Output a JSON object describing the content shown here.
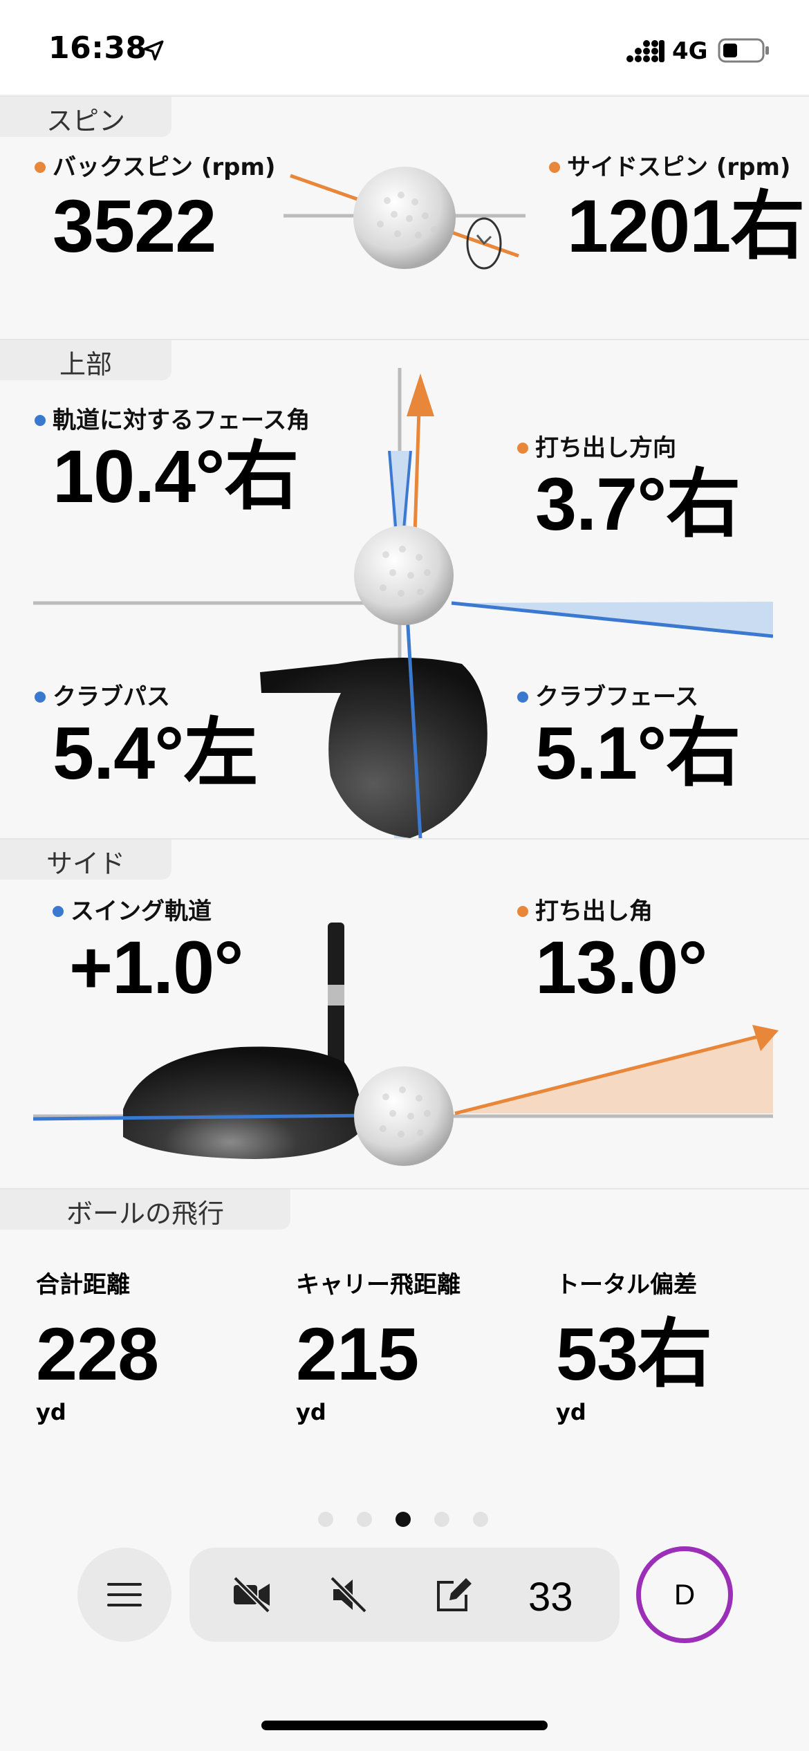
{
  "status_bar": {
    "time": "16:38",
    "network": "4G"
  },
  "spin": {
    "tab": "スピン",
    "backspin": {
      "label": "バックスピン (rpm)",
      "value": "3522"
    },
    "sidespin": {
      "label": "サイドスピン (rpm)",
      "value": "1201右"
    }
  },
  "top": {
    "tab": "上部",
    "face_to_path": {
      "label": "軌道に対するフェース角",
      "value": "10.4°右"
    },
    "launch_direction": {
      "label": "打ち出し方向",
      "value": "3.7°右"
    },
    "club_path": {
      "label": "クラブパス",
      "value": "5.4°左"
    },
    "club_face": {
      "label": "クラブフェース",
      "value": "5.1°右"
    }
  },
  "side": {
    "tab": "サイド",
    "swing_path": {
      "label": "スイング軌道",
      "value": "+1.0°"
    },
    "launch_angle": {
      "label": "打ち出し角",
      "value": "13.0°"
    }
  },
  "flight": {
    "tab": "ボールの飛行",
    "total": {
      "label": "合計距離",
      "value": "228",
      "unit": "yd"
    },
    "carry": {
      "label": "キャリー飛距離",
      "value": "215",
      "unit": "yd"
    },
    "deviation": {
      "label": "トータル偏差",
      "value": "53右",
      "unit": "yd"
    }
  },
  "pager": {
    "count": 5,
    "active_index": 2
  },
  "toolbar": {
    "menu_icon": "hamburger-icon",
    "video_icon": "video-off-icon",
    "sound_icon": "sound-off-icon",
    "edit_icon": "edit-icon",
    "shot_count": "33",
    "club_letter": "D"
  },
  "colors": {
    "orange": "#e8863a",
    "blue": "#3b78d0",
    "club_ring": "#9b2fb8"
  }
}
